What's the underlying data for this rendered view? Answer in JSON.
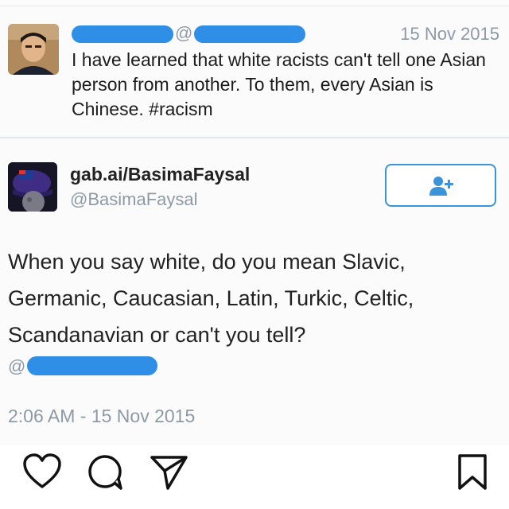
{
  "screenshot": {
    "reply_tweet": {
      "handle_prefix": "@",
      "date": "15 Nov 2015",
      "text": "I have learned that white racists can't tell one Asian person from another. To them, every Asian is Chinese. #racism"
    },
    "main_tweet": {
      "display_name": "gab.ai/BasimaFaysal",
      "handle": "@BasimaFaysal",
      "body": "When you say white, do you mean Slavic, Germanic, Caucasian, Latin, Turkic, Celtic, Scandanavian or can't you tell?",
      "mention_prefix": "@",
      "timestamp": "2:06 AM - 15 Nov 2015",
      "follow_icon": "add-user-icon"
    }
  },
  "action_bar": {
    "icons": [
      "heart-icon",
      "comment-icon",
      "share-icon",
      "bookmark-icon"
    ]
  },
  "colors": {
    "redaction": "#2f8fe6",
    "follow_accent": "#3b94d9",
    "muted_text": "#8d9aa6"
  }
}
